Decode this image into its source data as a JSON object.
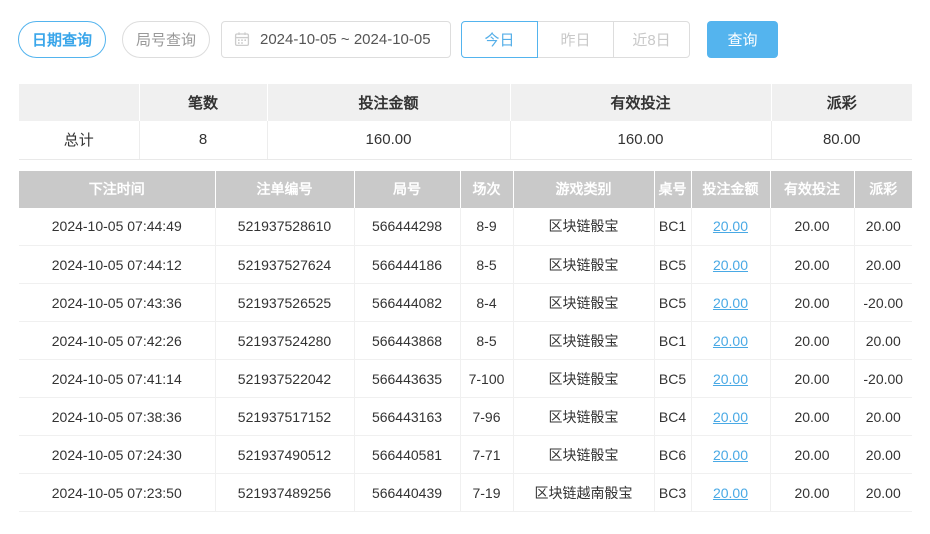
{
  "colors": {
    "accent": "#54b4ee",
    "link": "#49a9e5",
    "negative": "#f15b5b",
    "table_header_bg": "#c9c9c9",
    "summary_header_bg": "#f0f0f0"
  },
  "toolbar": {
    "date_query_label": "日期查询",
    "round_query_label": "局号查询",
    "date_range_value": "2024-10-05 ~ 2024-10-05",
    "today_label": "今日",
    "yesterday_label": "昨日",
    "last8_label": "近8日",
    "search_label": "查询"
  },
  "summary": {
    "headers": [
      "",
      "笔数",
      "投注金额",
      "有效投注",
      "派彩"
    ],
    "row_label": "总计",
    "count": "8",
    "bet_amount": "160.00",
    "valid_bet": "160.00",
    "payout": "80.00"
  },
  "records": {
    "headers": [
      "下注时间",
      "注单编号",
      "局号",
      "场次",
      "游戏类别",
      "桌号",
      "投注金额",
      "有效投注",
      "派彩"
    ],
    "rows": [
      {
        "time": "2024-10-05 07:44:49",
        "bet_no": "521937528610",
        "round_no": "566444298",
        "session": "8-9",
        "game": "区块链骰宝",
        "table_no": "BC1",
        "bet_amount": "20.00",
        "valid_bet": "20.00",
        "payout": "20.00",
        "payout_negative": false
      },
      {
        "time": "2024-10-05 07:44:12",
        "bet_no": "521937527624",
        "round_no": "566444186",
        "session": "8-5",
        "game": "区块链骰宝",
        "table_no": "BC5",
        "bet_amount": "20.00",
        "valid_bet": "20.00",
        "payout": "20.00",
        "payout_negative": false
      },
      {
        "time": "2024-10-05 07:43:36",
        "bet_no": "521937526525",
        "round_no": "566444082",
        "session": "8-4",
        "game": "区块链骰宝",
        "table_no": "BC5",
        "bet_amount": "20.00",
        "valid_bet": "20.00",
        "payout": "-20.00",
        "payout_negative": true
      },
      {
        "time": "2024-10-05 07:42:26",
        "bet_no": "521937524280",
        "round_no": "566443868",
        "session": "8-5",
        "game": "区块链骰宝",
        "table_no": "BC1",
        "bet_amount": "20.00",
        "valid_bet": "20.00",
        "payout": "20.00",
        "payout_negative": false
      },
      {
        "time": "2024-10-05 07:41:14",
        "bet_no": "521937522042",
        "round_no": "566443635",
        "session": "7-100",
        "game": "区块链骰宝",
        "table_no": "BC5",
        "bet_amount": "20.00",
        "valid_bet": "20.00",
        "payout": "-20.00",
        "payout_negative": true
      },
      {
        "time": "2024-10-05 07:38:36",
        "bet_no": "521937517152",
        "round_no": "566443163",
        "session": "7-96",
        "game": "区块链骰宝",
        "table_no": "BC4",
        "bet_amount": "20.00",
        "valid_bet": "20.00",
        "payout": "20.00",
        "payout_negative": false
      },
      {
        "time": "2024-10-05 07:24:30",
        "bet_no": "521937490512",
        "round_no": "566440581",
        "session": "7-71",
        "game": "区块链骰宝",
        "table_no": "BC6",
        "bet_amount": "20.00",
        "valid_bet": "20.00",
        "payout": "20.00",
        "payout_negative": false
      },
      {
        "time": "2024-10-05 07:23:50",
        "bet_no": "521937489256",
        "round_no": "566440439",
        "session": "7-19",
        "game": "区块链越南骰宝",
        "table_no": "BC3",
        "bet_amount": "20.00",
        "valid_bet": "20.00",
        "payout": "20.00",
        "payout_negative": false
      }
    ]
  }
}
